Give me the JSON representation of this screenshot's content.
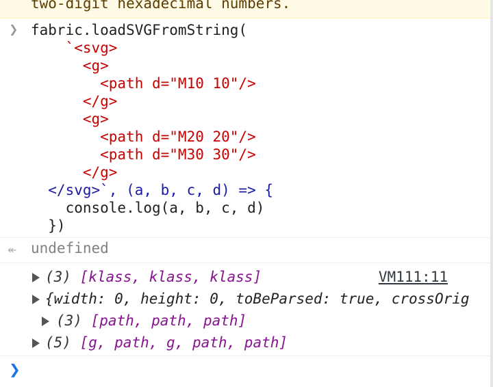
{
  "warning": {
    "text": "two-digit hexadecimal numbers."
  },
  "input": {
    "prompt_icon": "chevron-right-icon",
    "lines": [
      "fabric.loadSVGFromString(",
      "    `<svg>",
      "      <g>",
      "        <path d=\"M10 10\"/>",
      "      </g>",
      "      <g>",
      "        <path d=\"M20 20\"/>",
      "        <path d=\"M30 30\"/>",
      "      </g>",
      "  </svg>`, (a, b, c, d) => {",
      "    console.log(a, b, c, d)",
      "  })"
    ]
  },
  "result": {
    "icon": "return-arrow-icon",
    "text": "undefined"
  },
  "logs": [
    {
      "count": "(3)",
      "items": "[klass, klass, klass]",
      "source": "VM111:11"
    },
    {
      "object": "{width: 0, height: 0, toBeParsed: true, crossOrig"
    },
    {
      "count": "(3)",
      "items": "[path, path, path]"
    },
    {
      "count": "(5)",
      "items": "[g, path, g, path, path]"
    }
  ],
  "colors": {
    "tag": "#c80000",
    "param": "#1a1aa6",
    "property": "#881391",
    "number": "#1c00cf",
    "prompt": "#1a73e8"
  }
}
